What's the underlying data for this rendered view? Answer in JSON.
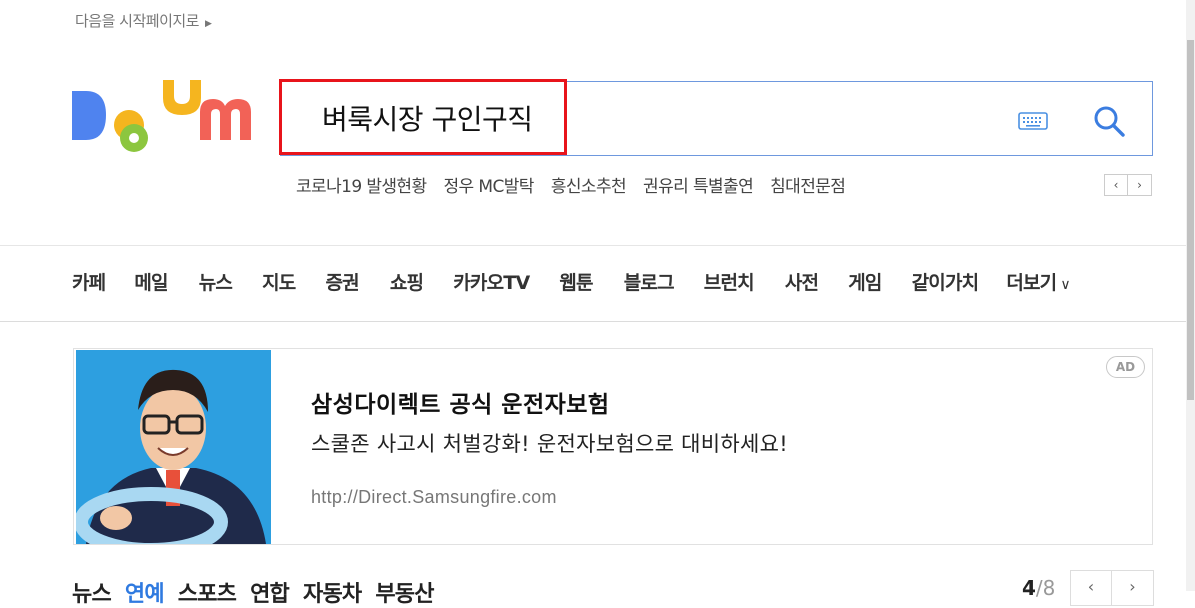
{
  "header": {
    "set_home": "다음을 시작페이지로"
  },
  "search": {
    "query": "벼룩시장 구인구직"
  },
  "issues": [
    "코로나19 발생현황",
    "정우 MC발탁",
    "흥신소추천",
    "권유리 특별출연",
    "침대전문점"
  ],
  "issue_nav": {
    "prev": "‹",
    "next": "›"
  },
  "gnb": {
    "items": [
      "카페",
      "메일",
      "뉴스",
      "지도",
      "증권",
      "쇼핑",
      "카카오TV",
      "웹툰",
      "블로그",
      "브런치",
      "사전",
      "게임",
      "같이가치"
    ],
    "more": "더보기"
  },
  "ad": {
    "badge": "AD",
    "title": "삼성다이렉트 공식 운전자보험",
    "desc": "스쿨존 사고시 처벌강화! 운전자보험으로 대비하세요!",
    "url": "http://Direct.Samsungfire.com"
  },
  "news": {
    "tabs": [
      "뉴스",
      "연예",
      "스포츠",
      "연합",
      "자동차",
      "부동산"
    ],
    "active_index": 1,
    "page": "4",
    "total": "/8"
  },
  "colors": {
    "accent": "#2f7ae0",
    "highlight": "#e8141b",
    "search_border": "#6e98de"
  }
}
